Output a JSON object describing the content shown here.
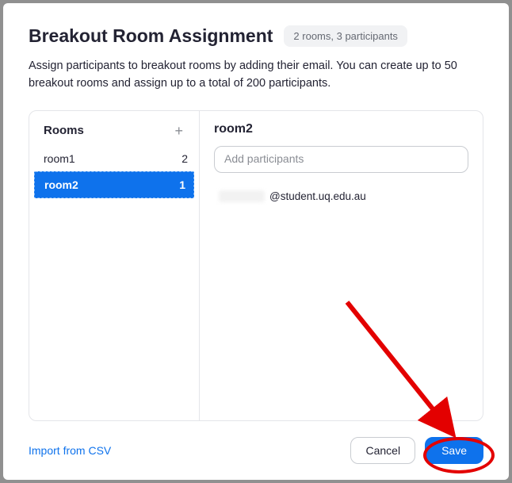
{
  "header": {
    "title": "Breakout Room Assignment",
    "badge": "2 rooms, 3 participants"
  },
  "description": "Assign participants to breakout rooms by adding their email. You can create up to 50 breakout rooms and assign up to a total of 200 participants.",
  "rooms": {
    "header_label": "Rooms",
    "add_icon": "+",
    "items": [
      {
        "name": "room1",
        "count": "2",
        "selected": false
      },
      {
        "name": "room2",
        "count": "1",
        "selected": true
      }
    ]
  },
  "detail": {
    "title": "room2",
    "input_placeholder": "Add participants",
    "participants": [
      {
        "email_visible": "@student.uq.edu.au"
      }
    ]
  },
  "footer": {
    "import_label": "Import from CSV",
    "cancel_label": "Cancel",
    "save_label": "Save"
  }
}
